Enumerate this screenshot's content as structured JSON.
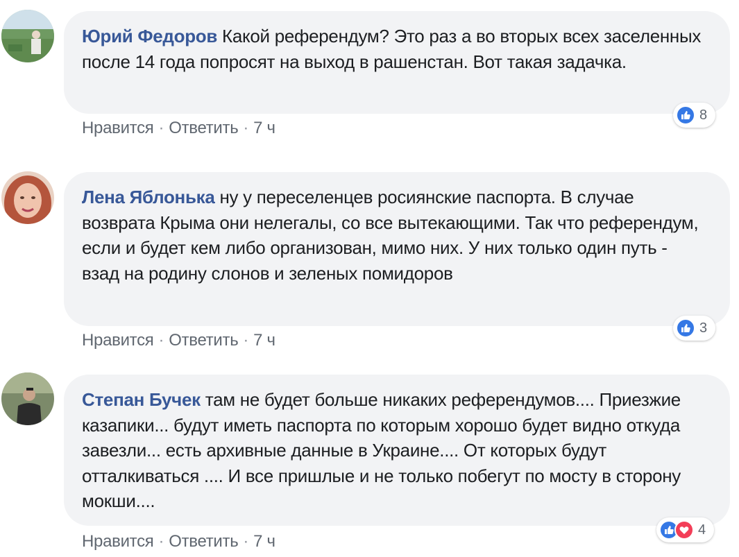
{
  "comments": [
    {
      "author": "Юрий Федоров",
      "text": "Какой референдум? Это раз а во вторых всех заселенных после 14 года попросят на выход в рашенстан. Вот такая задачка.",
      "actions": {
        "like": "Нравится",
        "reply": "Ответить",
        "time": "7 ч",
        "separator": "·"
      },
      "reactions": {
        "types": [
          "like-icon"
        ],
        "count": "8"
      }
    },
    {
      "author": "Лена Яблонька",
      "text": "ну у переселенцев росиянские паспорта. В случае возврата Крыма они нелегалы, со все вытекающими. Так что референдум, если и будет кем либо организован, мимо них. У них только один путь - взад на родину слонов и зеленых помидоров",
      "actions": {
        "like": "Нравится",
        "reply": "Ответить",
        "time": "7 ч",
        "separator": "·"
      },
      "reactions": {
        "types": [
          "like-icon"
        ],
        "count": "3"
      }
    },
    {
      "author": "Степан Бучек",
      "text": "там не будет больше никаких референдумов.... Приезжие кaзапики... будут иметь паспорта по которым хорошо будет видно откуда завезли... есть архивные данные в Украине.... От которых будут отталкиваться .... И все пришлые и не только побегут по мосту в сторону мокши....",
      "actions": {
        "like": "Нравится",
        "reply": "Ответить",
        "time": "7 ч",
        "separator": "·"
      },
      "reactions": {
        "types": [
          "like-icon",
          "love-icon"
        ],
        "count": "4"
      }
    }
  ],
  "colors": {
    "author": "#385898",
    "bubble": "#f2f3f5",
    "actions": "#606770",
    "like": "#3578e5",
    "love": "#f33e58"
  }
}
